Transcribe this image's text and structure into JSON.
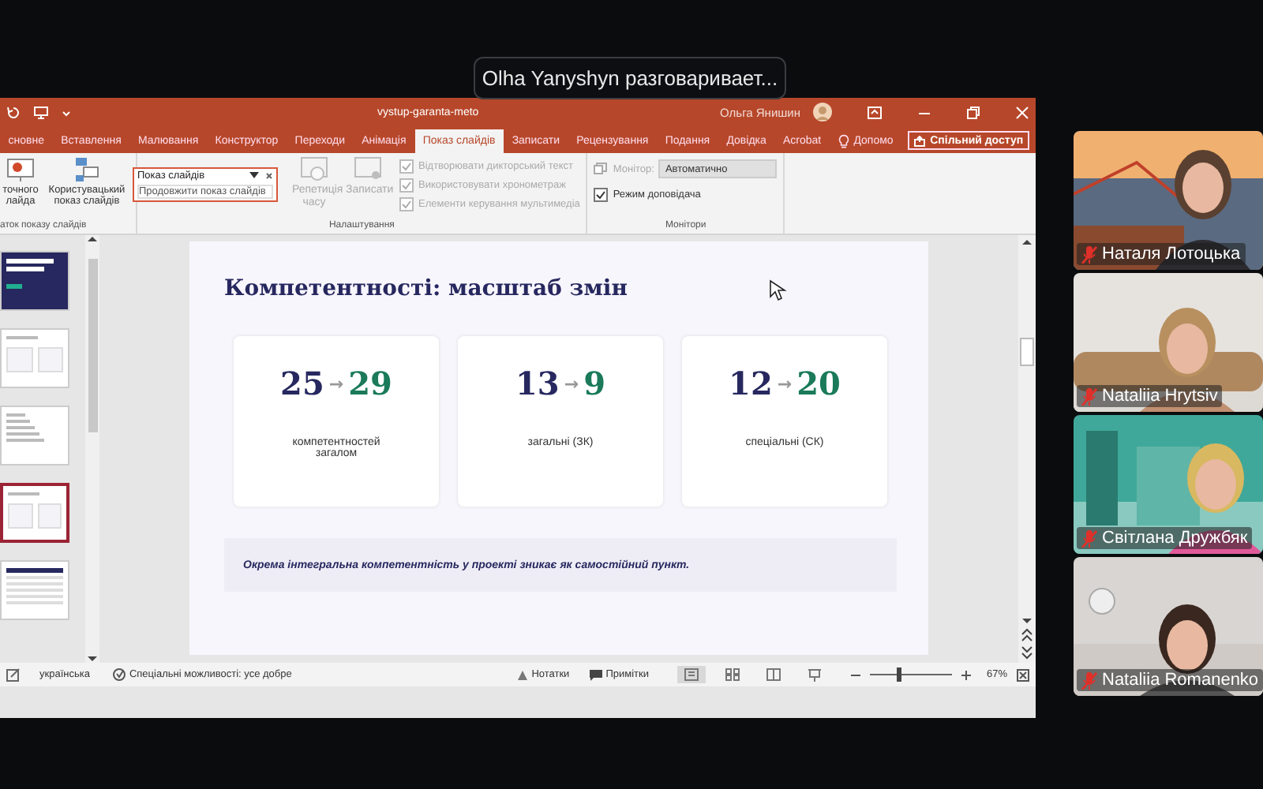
{
  "toast": {
    "text": "Olha Yanyshyn разговаривает..."
  },
  "powerpoint": {
    "title_bar": {
      "title": "vystup-garanta-meto",
      "user": "Ольга Янишин"
    },
    "tabs": [
      {
        "label": "сновне",
        "selected": false
      },
      {
        "label": "Вставлення",
        "selected": false
      },
      {
        "label": "Малювання",
        "selected": false
      },
      {
        "label": "Конструктор",
        "selected": false
      },
      {
        "label": "Переходи",
        "selected": false
      },
      {
        "label": "Анімація",
        "selected": false
      },
      {
        "label": "Показ слайдів",
        "selected": true
      },
      {
        "label": "Записати",
        "selected": false
      },
      {
        "label": "Рецензування",
        "selected": false
      },
      {
        "label": "Подання",
        "selected": false
      },
      {
        "label": "Довідка",
        "selected": false
      },
      {
        "label": "Acrobat",
        "selected": false
      }
    ],
    "help": "Допомо",
    "share_button": "Спільний доступ",
    "ribbon": {
      "start_group": {
        "buttons": [
          {
            "label": "точного лайда",
            "disabled": false
          },
          {
            "label": "Користувацький показ слайдів",
            "disabled": false
          }
        ],
        "label": "аток показу слайдів"
      },
      "setup_group": {
        "buttons": [
          {
            "label": "Репетиція часу",
            "disabled": true
          },
          {
            "label": "Записати",
            "disabled": true
          }
        ],
        "checkboxes": [
          {
            "label": "Відтворювати дикторський текст",
            "checked": true,
            "disabled": true
          },
          {
            "label": "Використовувати хронометраж",
            "checked": true,
            "disabled": true
          },
          {
            "label": "Елементи керування мультимедіа",
            "checked": true,
            "disabled": true
          }
        ],
        "label": "Налаштування"
      },
      "monitors_group": {
        "monitor_label": "Монітор:",
        "monitor_value": "Автоматично",
        "checkboxes": [
          {
            "label": "Режим доповідача",
            "checked": true,
            "disabled": false
          }
        ],
        "label": "Монітори"
      }
    },
    "popup": {
      "title": "Показ слайдів",
      "item": "Продовжити показ слайдів"
    },
    "thumbnails": [
      {
        "kind": "dark",
        "selected": false
      },
      {
        "kind": "cards",
        "selected": false
      },
      {
        "kind": "list",
        "selected": false
      },
      {
        "kind": "cards",
        "selected": true
      },
      {
        "kind": "table",
        "selected": false
      }
    ],
    "slide": {
      "title": "Компетентності: масштаб змін",
      "cards": [
        {
          "from": "25",
          "arrow": "→",
          "to": "29",
          "label": "компетентностей загалом"
        },
        {
          "from": "13",
          "arrow": "→",
          "to": "9",
          "label": "загальні (ЗК)"
        },
        {
          "from": "12",
          "arrow": "→",
          "to": "20",
          "label": "спеціальні (СК)"
        }
      ],
      "note": "Окрема інтегральна компетентність у проекті зникає як самостійний пункт."
    },
    "status_bar": {
      "language": "українська",
      "accessibility": "Спеціальні можливості: усе добре",
      "notes": "Нотатки",
      "comments": "Примітки",
      "zoom": {
        "level": 0.35,
        "reading": "67%"
      }
    }
  },
  "participants": [
    {
      "name": "Наталя Лотоцька",
      "muted": true
    },
    {
      "name": "Nataliia Hrytsiv",
      "muted": true
    },
    {
      "name": "Світлана Дружбяк",
      "muted": true
    },
    {
      "name": "Nataliia Romanenko",
      "muted": true
    }
  ]
}
